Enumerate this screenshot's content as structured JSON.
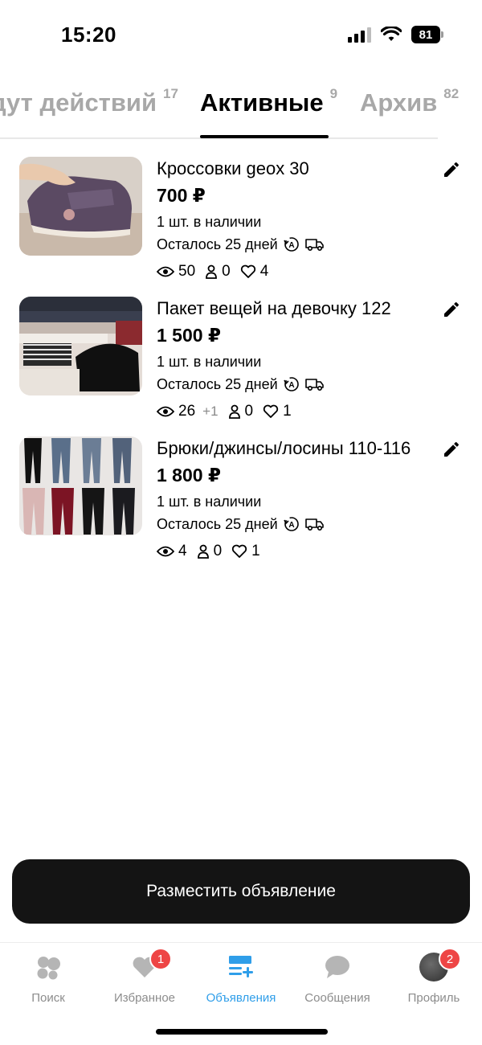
{
  "status": {
    "time": "15:20",
    "battery": "81"
  },
  "tabs": [
    {
      "label": "дут действий",
      "count": "17"
    },
    {
      "label": "Активные",
      "count": "9"
    },
    {
      "label": "Архив",
      "count": "82"
    }
  ],
  "listings": [
    {
      "title": "Кроссовки geox 30",
      "price": "700 ₽",
      "stock": "1 шт. в наличии",
      "days": "Осталось 25 дней",
      "views": "50",
      "views_delta": "",
      "contacts": "0",
      "likes": "4",
      "thumb": "sneakers"
    },
    {
      "title": "Пакет вещей на девочку 122",
      "price": "1 500 ₽",
      "stock": "1 шт. в наличии",
      "days": "Осталось 25 дней",
      "views": "26",
      "views_delta": "+1",
      "contacts": "0",
      "likes": "1",
      "thumb": "clothes"
    },
    {
      "title": "Брюки/джинсы/лосины 110-116",
      "price": "1 800 ₽",
      "stock": "1 шт. в наличии",
      "days": "Осталось 25 дней",
      "views": "4",
      "views_delta": "",
      "contacts": "0",
      "likes": "1",
      "thumb": "pants"
    }
  ],
  "post_button": "Разместить объявление",
  "tabbar": {
    "items": [
      {
        "label": "Поиск",
        "icon": "search-bubbles-icon"
      },
      {
        "label": "Избранное",
        "icon": "heart-icon",
        "badge": "1"
      },
      {
        "label": "Объявления",
        "icon": "listings-icon"
      },
      {
        "label": "Сообщения",
        "icon": "chat-icon"
      },
      {
        "label": "Профиль",
        "icon": "avatar",
        "badge": "2"
      }
    ]
  },
  "colors": {
    "accent": "#2f9ee9",
    "badge": "#ee4545",
    "button": "#141414",
    "inactive": "#8c8c8c"
  }
}
